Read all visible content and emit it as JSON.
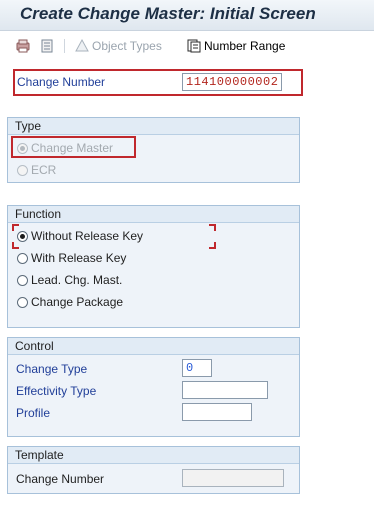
{
  "window": {
    "title": "Create Change Master: Initial Screen"
  },
  "toolbar": {
    "object_types_label": "Object Types",
    "number_range_label": "Number Range"
  },
  "header_field": {
    "label": "Change Number",
    "value": "114100000002"
  },
  "type_group": {
    "title": "Type",
    "options": [
      {
        "label": "Change Master",
        "checked": true,
        "enabled": false
      },
      {
        "label": "ECR",
        "checked": false,
        "enabled": false
      }
    ]
  },
  "function_group": {
    "title": "Function",
    "options": [
      {
        "label": "Without Release Key",
        "checked": true
      },
      {
        "label": "With Release Key",
        "checked": false
      },
      {
        "label": "Lead. Chg. Mast.",
        "checked": false
      },
      {
        "label": "Change Package",
        "checked": false
      }
    ]
  },
  "control_group": {
    "title": "Control",
    "change_type": {
      "label": "Change Type",
      "value": "0"
    },
    "effectivity_type": {
      "label": "Effectivity Type",
      "value": ""
    },
    "profile": {
      "label": "Profile",
      "value": ""
    }
  },
  "template_group": {
    "title": "Template",
    "change_number": {
      "label": "Change Number",
      "value": ""
    }
  },
  "colors": {
    "highlight": "#c0282d",
    "label_blue": "#213f99",
    "group_bg": "#eef3f9"
  }
}
